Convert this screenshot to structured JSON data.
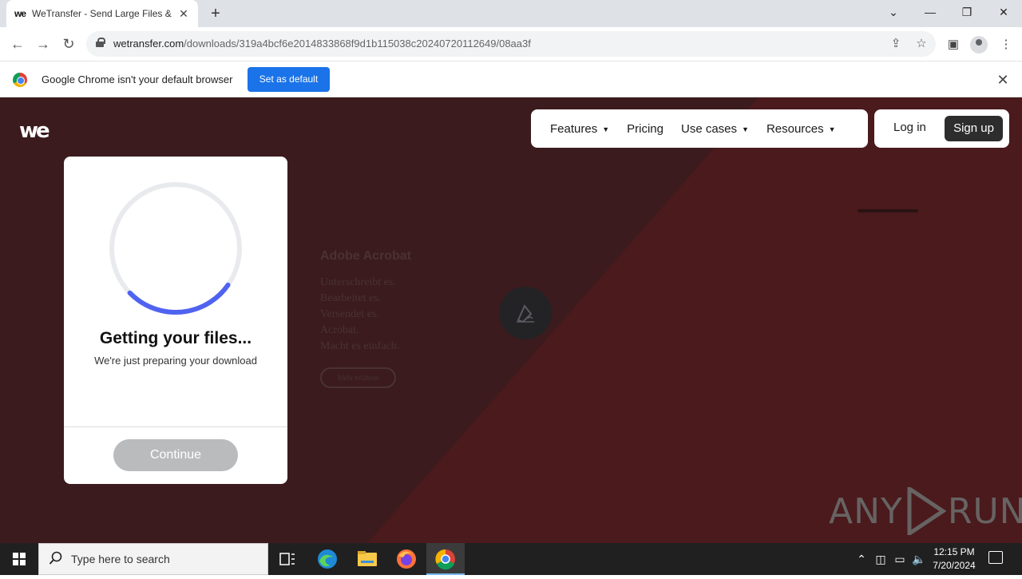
{
  "browser": {
    "tab_title": "WeTransfer - Send Large Files &",
    "tab_favicon_text": "we",
    "url_domain": "wetransfer.com",
    "url_path": "/downloads/319a4bcf6e2014833868f9d1b115038c20240720112649/08aa3f"
  },
  "infobar": {
    "message": "Google Chrome isn't your default browser",
    "button": "Set as default"
  },
  "site": {
    "logo": "we",
    "nav": {
      "features": "Features",
      "pricing": "Pricing",
      "use_cases": "Use cases",
      "resources": "Resources"
    },
    "login": "Log in",
    "signup": "Sign up",
    "download_card": {
      "title": "Getting your files...",
      "subtitle": "We're just preparing your download",
      "continue": "Continue",
      "progress": 0.28
    },
    "ad": {
      "brand": "Adobe Acrobat",
      "lines": [
        "Unterschreibt es.",
        "Bearbeitet es.",
        "Versendet es.",
        "Acrobat.",
        "Macht es einfach."
      ],
      "cta": "Mehr erfahren"
    }
  },
  "watermark": {
    "left": "ANY",
    "right": "RUN"
  },
  "taskbar": {
    "search_placeholder": "Type here to search",
    "time": "12:15 PM",
    "date": "7/20/2024"
  },
  "colors": {
    "page_bg": "#3b1b1d",
    "page_bg_right": "#4a1a1c",
    "spinner_track": "#e8eaee",
    "spinner_progress": "#4f63f0",
    "chrome_blue": "#1a73e8",
    "signup_bg": "#2d2d2d"
  }
}
